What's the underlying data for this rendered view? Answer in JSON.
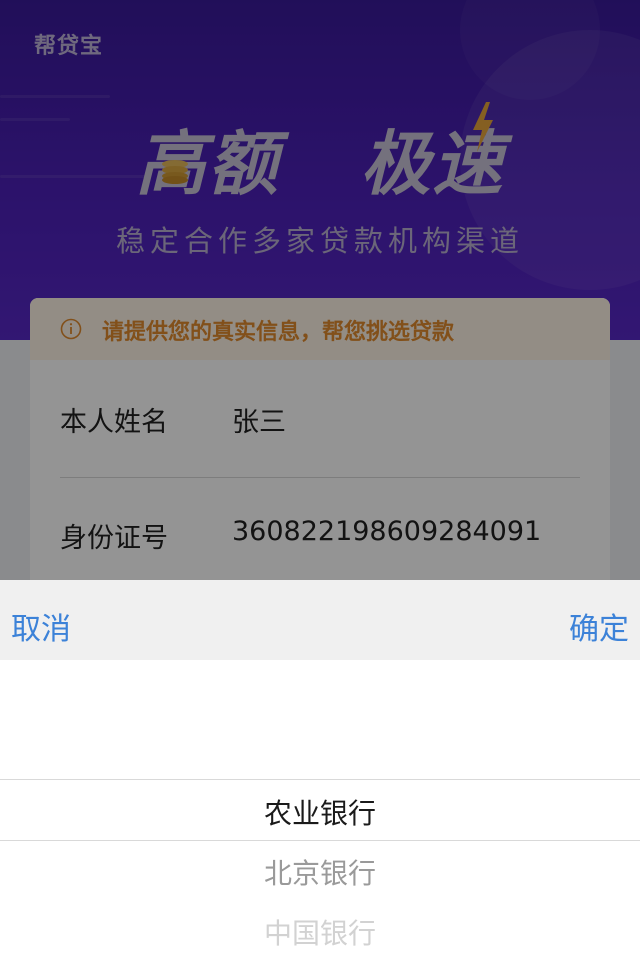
{
  "hero": {
    "brand": "帮贷宝",
    "headline_part1": "高额",
    "headline_part2": "极速",
    "subhead": "稳定合作多家贷款机构渠道",
    "icons": [
      "coin-stack-icon",
      "lightning-bolt-icon"
    ]
  },
  "form": {
    "notice": "请提供您的真实信息，帮您挑选贷款",
    "notice_icon": "info-circle-icon",
    "fields": [
      {
        "label": "本人姓名",
        "value": "张三"
      },
      {
        "label": "身份证号",
        "value": "360822198609284091"
      }
    ]
  },
  "picker": {
    "cancel_label": "取消",
    "confirm_label": "确定",
    "options": [
      "农业银行",
      "北京银行",
      "中国银行"
    ],
    "selected": "农业银行"
  },
  "colors": {
    "hero_bg": "#4c20b8",
    "accent_blue": "#3c82d8",
    "notice_text": "#e08a2e",
    "notice_bg": "#fdf3e6",
    "toolbar_bg": "#f0f0f0"
  }
}
